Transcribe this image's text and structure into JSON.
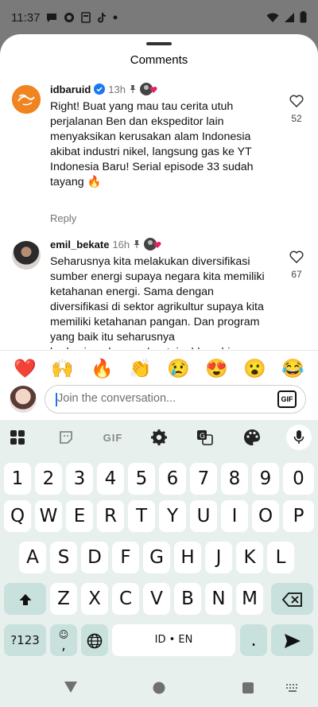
{
  "status": {
    "time": "11:37"
  },
  "sheet": {
    "title": "Comments"
  },
  "comments": [
    {
      "user": "idbaruid",
      "time": "13h",
      "text": "Right! Buat yang mau tau cerita utuh\nperjalanan Ben dan ekspeditor lain\nmenyaksikan kerusakan alam Indonesia\nakibat industri nikel, langsung gas ke YT\nIndonesia Baru! Serial episode 33 sudah\ntayang 🔥",
      "reply": "Reply",
      "likes": "52"
    },
    {
      "user": "emil_bekate",
      "time": "16h",
      "text": "Seharusnya kita melakukan diversifikasi\nsumber energi supaya negara kita memiliki\nketahanan energi. Sama dengan\ndiversifikasi di sektor agrikultur supaya kita\nmemiliki ketahanan pangan. Dan program\nyang baik itu seharusnya\nberkesinambungan/sustainable sehingga\ngenerasi mendatang tetap bisa menikmati\ndan kualitas hidup mereka tidak menurun\nakibat kebijakan pemerintah saat ini.\nApalagi disaat dunia yang sekarang ini",
      "likes": "67"
    }
  ],
  "emojis": [
    "❤️",
    "🙌",
    "🔥",
    "👏",
    "😢",
    "😍",
    "😮",
    "😂"
  ],
  "input": {
    "placeholder": "Join the conversation...",
    "gif_label": "GIF"
  },
  "keyboard": {
    "tool_gif": "GIF",
    "row_numbers": [
      "1",
      "2",
      "3",
      "4",
      "5",
      "6",
      "7",
      "8",
      "9",
      "0"
    ],
    "row1": [
      "Q",
      "W",
      "E",
      "R",
      "T",
      "Y",
      "U",
      "I",
      "O",
      "P"
    ],
    "row2": [
      "A",
      "S",
      "D",
      "F",
      "G",
      "H",
      "J",
      "K",
      "L"
    ],
    "row3": [
      "Z",
      "X",
      "C",
      "V",
      "B",
      "N",
      "M"
    ],
    "symbols_key": "?123",
    "emoji_comma": ",",
    "space_label": "ID • EN",
    "period": "."
  },
  "colors": {
    "accent": "#1a73e8",
    "key_dark": "#c9e1dc",
    "keyboard_bg": "#e8f0ee",
    "verified": "#1877f2",
    "heart_red": "#e0245e"
  }
}
